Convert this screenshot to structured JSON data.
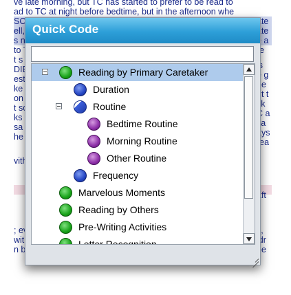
{
  "background_doc": {
    "lines": [
      "ve late morning, but TC has started to prefer to be read to",
      "ad to TC at night before bedtime, but in the afternoon whe",
      "SC",
      "ell,",
      "s n",
      "to T",
      "t s",
      "DIE",
      "esti",
      "ke v",
      "on",
      "t sc",
      "ks",
      "sa",
      "he",
      "",
      "vith",
      "",
      "",
      "",
      "; ev",
      "wit",
      "n b"
    ],
    "right_fragments": [
      "ate",
      "ate",
      "e a",
      "re",
      "is",
      "e g",
      "he",
      "ut t",
      "sk",
      "C a",
      "sa",
      "ays",
      "rea",
      "",
      "",
      "aft",
      "",
      "",
      "s,",
      "idr",
      "he"
    ]
  },
  "popup": {
    "title": "Quick Code",
    "search_value": "",
    "tree": [
      {
        "label": "Reading by Primary Caretaker",
        "color": "green",
        "expanded": true,
        "selected": true
      },
      {
        "label": "Duration",
        "color": "blue"
      },
      {
        "label": "Routine",
        "color": "bluehalf",
        "expanded": true
      },
      {
        "label": "Bedtime Routine",
        "color": "purple"
      },
      {
        "label": "Morning Routine",
        "color": "purple"
      },
      {
        "label": "Other Routine",
        "color": "purple"
      },
      {
        "label": "Frequency",
        "color": "blue"
      },
      {
        "label": "Marvelous Moments",
        "color": "green"
      },
      {
        "label": "Reading by Others",
        "color": "green"
      },
      {
        "label": "Pre-Writing Activities",
        "color": "green"
      },
      {
        "label": "Letter Recognition",
        "color": "green"
      }
    ]
  },
  "colors": {
    "title_bar": "#2d9fd8",
    "selection": "#aecbec",
    "doc_text": "#1a2a8a"
  }
}
